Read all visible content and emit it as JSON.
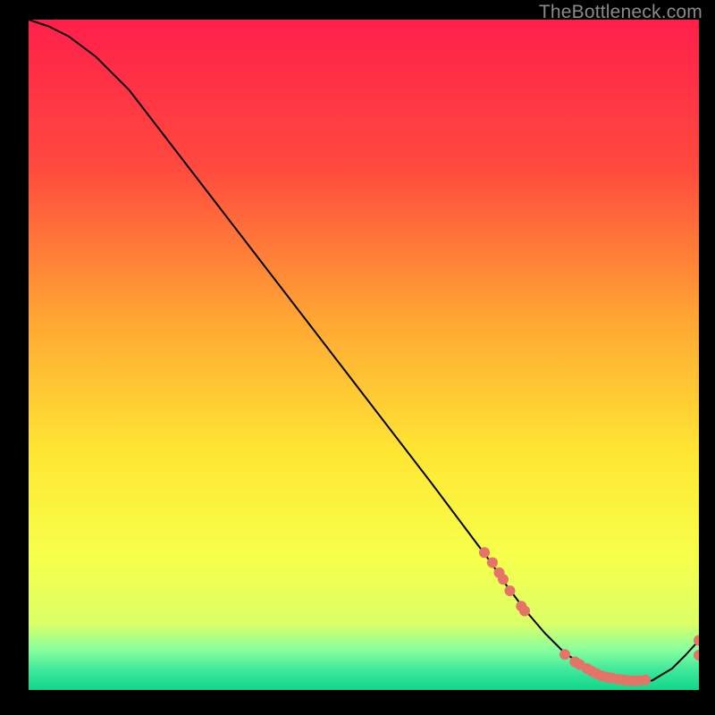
{
  "watermark": "TheBottleneck.com",
  "chart_data": {
    "type": "line",
    "title": "",
    "xlabel": "",
    "ylabel": "",
    "xlim": [
      0,
      100
    ],
    "ylim": [
      0,
      100
    ],
    "background_gradient": {
      "top": "#ff1f4b",
      "mid_upper": "#ff7a33",
      "mid": "#ffd633",
      "mid_lower": "#f7ff33",
      "low_band": "#d6ff66",
      "green_top": "#5fff9e",
      "green_bottom": "#10d68c"
    },
    "series": [
      {
        "name": "curve",
        "color": "#000000",
        "x": [
          0,
          3,
          6,
          10,
          15,
          20,
          25,
          30,
          35,
          40,
          45,
          50,
          55,
          60,
          63,
          66,
          69,
          71,
          74,
          77,
          80,
          83,
          85,
          88,
          90,
          93,
          96,
          98,
          100
        ],
        "y": [
          100,
          99,
          97.5,
          94.5,
          89.5,
          83,
          76.5,
          70,
          63.5,
          57,
          50.5,
          44,
          37.5,
          31,
          27,
          23,
          19,
          16,
          12,
          8.5,
          5.5,
          3.5,
          2.3,
          1.6,
          1.3,
          1.4,
          3.2,
          5.2,
          7.4
        ]
      }
    ],
    "points": {
      "name": "dots",
      "color": "#e57368",
      "radius": 6,
      "x": [
        68.0,
        69.2,
        70.2,
        70.8,
        71.8,
        73.5,
        74.0,
        80.0,
        81.5,
        82.2,
        83.3,
        84.0,
        84.8,
        85.5,
        86.3,
        87.0,
        88.0,
        88.8,
        89.5,
        90.3,
        91.0,
        92.0,
        100.0,
        100.0
      ],
      "y": [
        20.5,
        19.0,
        17.5,
        16.5,
        14.8,
        12.5,
        11.8,
        5.3,
        4.2,
        3.8,
        3.2,
        2.8,
        2.4,
        2.1,
        1.9,
        1.8,
        1.6,
        1.5,
        1.4,
        1.4,
        1.4,
        1.5,
        5.2,
        7.4
      ]
    }
  }
}
